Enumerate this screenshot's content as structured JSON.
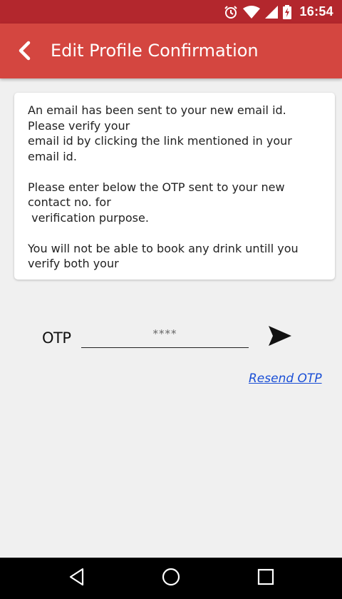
{
  "status_bar": {
    "time": "16:54",
    "icons": [
      "alarm-icon",
      "wifi-icon",
      "signal-icon",
      "battery-charging-icon"
    ]
  },
  "app_bar": {
    "title": "Edit Profile Confirmation",
    "back_icon": "back-arrow-icon"
  },
  "message": {
    "paragraph1": "An email has been sent to your new email id. Please verify your\nemail id by clicking the link mentioned in your email id.",
    "paragraph2": "Please enter below the OTP sent to your new contact no. for\n verification purpose.",
    "paragraph3": "You will not be able to book any drink untill you verify both your"
  },
  "otp": {
    "label": "OTP",
    "value": "",
    "placeholder": "****",
    "send_icon": "send-icon"
  },
  "resend_link": "Resend OTP",
  "nav_bar": {
    "icons": [
      "back-triangle-icon",
      "home-circle-icon",
      "recents-square-icon"
    ]
  },
  "colors": {
    "status_bar": "#b3272d",
    "app_bar": "#d44640",
    "background": "#f0f0f0",
    "link": "#1a4fd6"
  }
}
